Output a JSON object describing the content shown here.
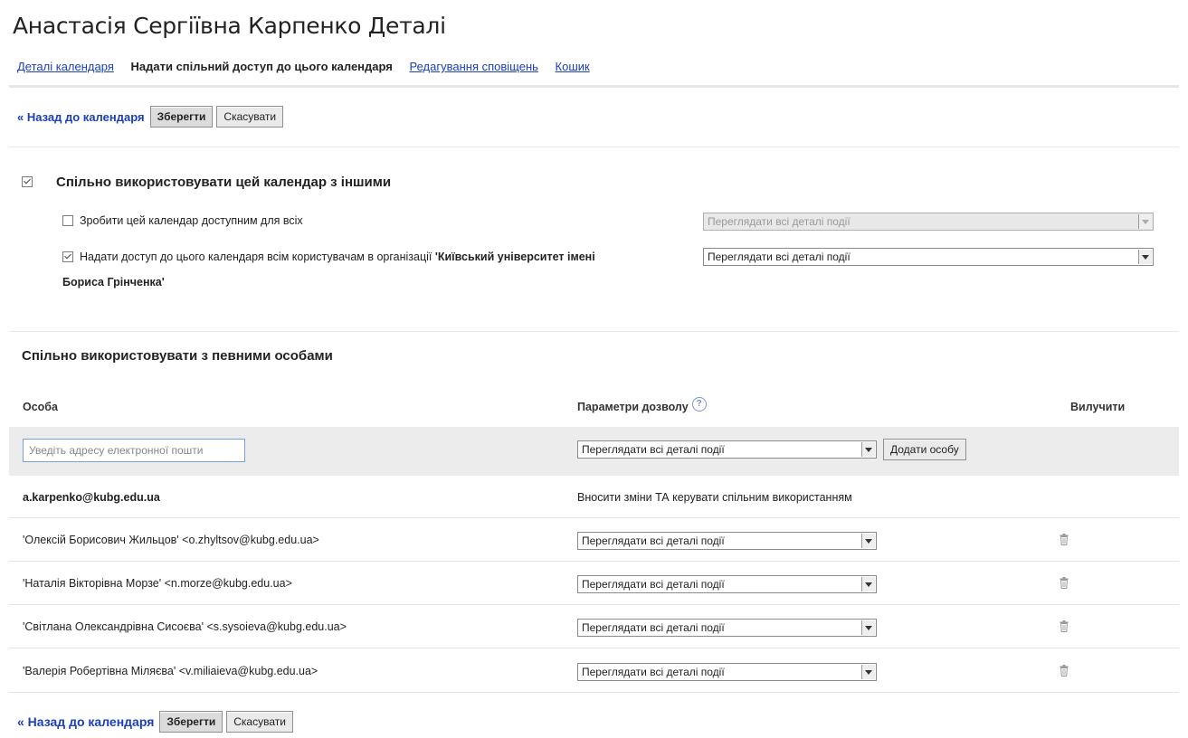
{
  "page": {
    "title": "Анастасія Сергіївна Карпенко Деталі"
  },
  "tabs": [
    {
      "label": "Деталі календаря",
      "active": false
    },
    {
      "label": "Надати спільний доступ до цього календаря",
      "active": true
    },
    {
      "label": "Редагування сповіщень",
      "active": false
    },
    {
      "label": "Кошик",
      "active": false
    }
  ],
  "actions": {
    "back_label": "« Назад до календаря",
    "save_label": "Зберегти",
    "cancel_label": "Скасувати"
  },
  "share_all": {
    "checked": true,
    "title": "Спільно використовувати цей календар з іншими",
    "public": {
      "checked": false,
      "label": "Зробити цей календар доступним для всіх",
      "select_value": "Переглядати всі деталі події",
      "disabled": true
    },
    "org": {
      "checked": true,
      "label_prefix": "Надати доступ до цього календаря всім користувачам в організації ",
      "org_name": "'Київський університет імені",
      "org_name_line2": "Бориса Грінченка'",
      "select_value": "Переглядати всі деталі події"
    }
  },
  "specific": {
    "title": "Спільно використовувати з певними особами",
    "col_person": "Особа",
    "col_permission": "Параметри дозволу",
    "col_remove": "Вилучити",
    "help_icon": "?",
    "email_placeholder": "Уведіть адресу електронної пошти",
    "new_permission": "Переглядати всі деталі події",
    "add_button": "Додати особу",
    "owner": {
      "email": "a.karpenko@kubg.edu.ua",
      "permission": "Вносити зміни ТА керувати спільним використанням"
    },
    "people": [
      {
        "name": "'Олексій Борисович Жильцов'",
        "email": " <o.zhyltsov@kubg.edu.ua>",
        "permission": "Переглядати всі деталі події"
      },
      {
        "name": "'Наталія Вікторівна Морзе'",
        "email": " <n.morze@kubg.edu.ua>",
        "permission": "Переглядати всі деталі події"
      },
      {
        "name": "'Світлана Олександрівна Сисоєва'",
        "email": " <s.sysoieva@kubg.edu.ua>",
        "permission": "Переглядати всі деталі події"
      },
      {
        "name": "'Валерія Робертівна Міляєва'",
        "email": " <v.miliaieva@kubg.edu.ua>",
        "permission": "Переглядати всі деталі події"
      }
    ]
  },
  "colors": {
    "link": "#1a3fb6",
    "band": "#ececec"
  }
}
